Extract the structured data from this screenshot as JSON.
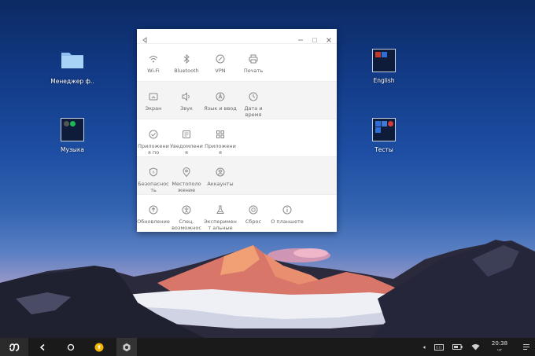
{
  "desktop": {
    "icons": [
      {
        "label": "Менеджер ф..",
        "icon": "folder-icon"
      },
      {
        "label": "Музыка",
        "icon": "music-app-thumbnail-icon"
      },
      {
        "label": "English",
        "icon": "english-app-thumbnail-icon"
      },
      {
        "label": "Тесты",
        "icon": "tests-app-thumbnail-icon"
      }
    ]
  },
  "window": {
    "titlebar": {
      "back_icon": "back-triangle-icon",
      "minimize_icon": "minimize-icon",
      "maximize_icon": "maximize-icon",
      "close_icon": "close-icon"
    },
    "rows": [
      {
        "items": [
          {
            "label": "Wi-Fi",
            "icon": "wifi-icon"
          },
          {
            "label": "Bluetooth",
            "icon": "bluetooth-icon"
          },
          {
            "label": "VPN",
            "icon": "vpn-icon"
          },
          {
            "label": "Печать",
            "icon": "printer-icon"
          }
        ]
      },
      {
        "items": [
          {
            "label": "Экран",
            "icon": "display-icon"
          },
          {
            "label": "Звук",
            "icon": "speaker-icon"
          },
          {
            "label": "Язык и ввод",
            "icon": "language-icon"
          },
          {
            "label": "Дата и время",
            "icon": "clock-icon"
          }
        ]
      },
      {
        "items": [
          {
            "label": "Приложени я по",
            "icon": "default-apps-icon"
          },
          {
            "label": "Уведомлени я",
            "icon": "notifications-icon"
          },
          {
            "label": "Приложени я",
            "icon": "apps-grid-icon"
          }
        ]
      },
      {
        "items": [
          {
            "label": "Безопаснос ть",
            "icon": "shield-icon"
          },
          {
            "label": "Местополо жение",
            "icon": "location-icon"
          },
          {
            "label": "Аккаунты",
            "icon": "account-icon"
          }
        ]
      },
      {
        "items": [
          {
            "label": "Обновление",
            "icon": "update-icon"
          },
          {
            "label": "Спец. возможнос",
            "icon": "accessibility-icon"
          },
          {
            "label": "Эксперимент альные",
            "icon": "flask-icon"
          },
          {
            "label": "Сброс",
            "icon": "reset-icon"
          },
          {
            "label": "О планшете",
            "icon": "info-icon"
          }
        ]
      }
    ]
  },
  "taskbar": {
    "start_icon": "phoenix-os-logo-icon",
    "back_icon": "back-arrow-icon",
    "home_icon": "home-circle-icon",
    "pinned_app_icon": "yellow-app-icon",
    "settings_app_icon": "settings-gear-icon",
    "tray_arrow_icon": "tray-expand-icon",
    "keyboard_icon": "keyboard-icon",
    "battery_icon": "battery-icon",
    "wifi_icon": "wifi-status-icon",
    "time": "20:38",
    "day": "чт",
    "notifications_icon": "notifications-menu-icon"
  },
  "colors": {
    "icon_stroke": "#8a8a8a",
    "taskbar_bg": "#1a1a1a",
    "folder": "#9dc8f0",
    "pinned_app": "#f5b400"
  }
}
